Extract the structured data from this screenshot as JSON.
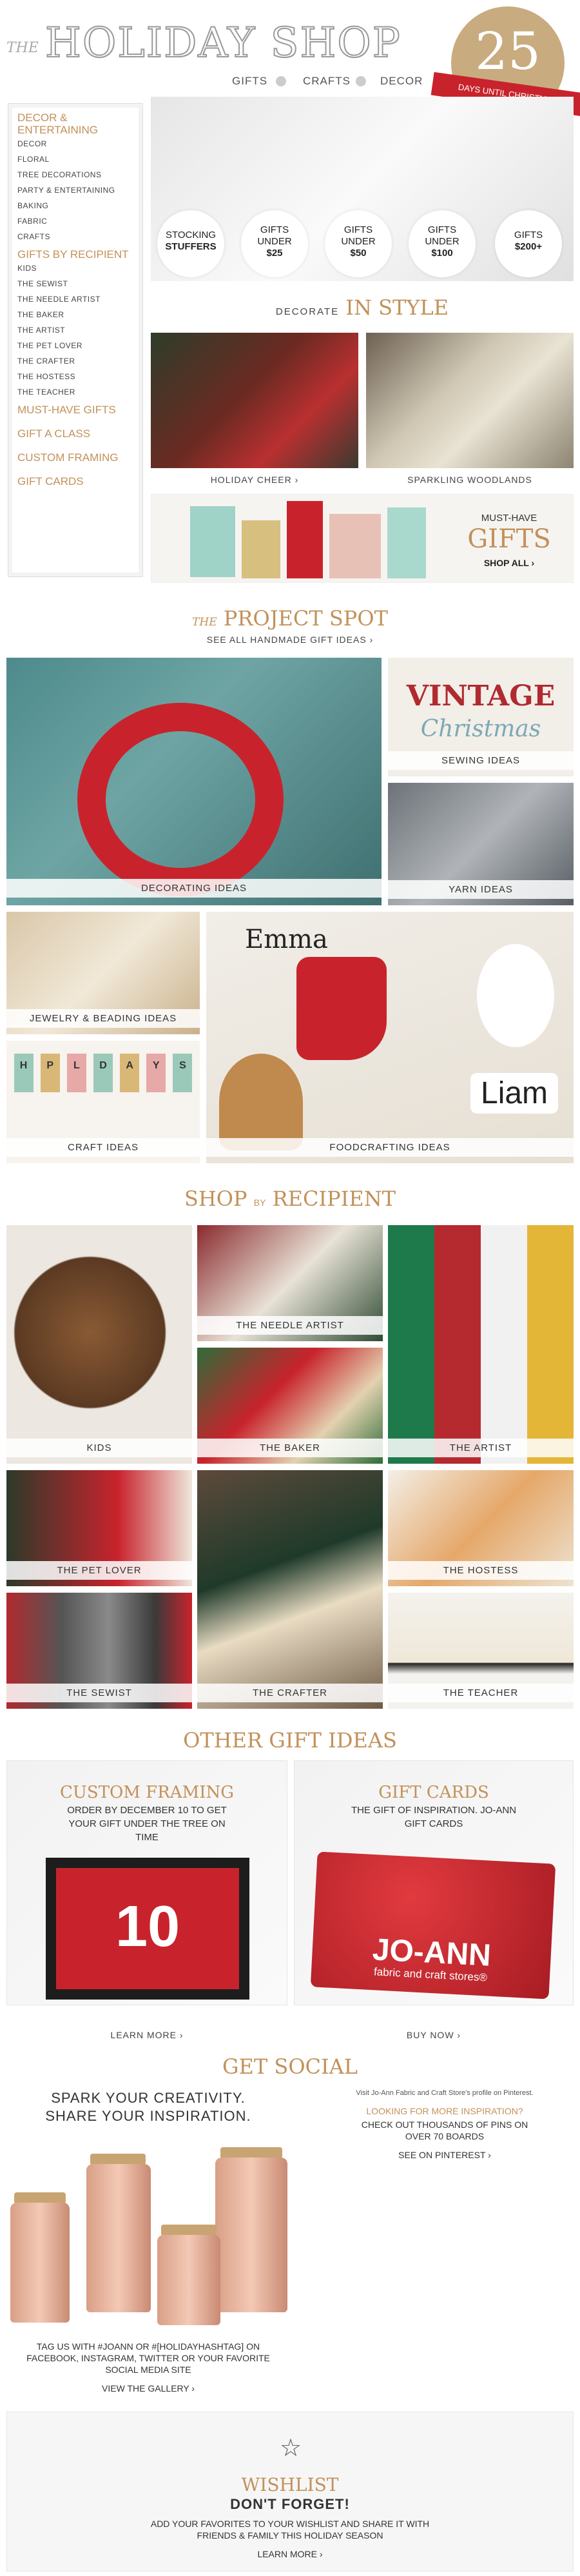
{
  "header": {
    "the": "THE",
    "title": "HOLIDAY SHOP",
    "nav": [
      "GIFTS",
      "CRAFTS",
      "DECOR"
    ],
    "countdown_number": "25",
    "countdown_label": "DAYS UNTIL CHRISTMAS"
  },
  "sidebar": {
    "groups": [
      {
        "title": "DECOR & ENTERTAINING",
        "items": [
          "DECOR",
          "FLORAL",
          "TREE DECORATIONS",
          "PARTY & ENTERTAINING",
          "BAKING",
          "FABRIC",
          "CRAFTS"
        ]
      },
      {
        "title": "GIFTS BY RECIPIENT",
        "items": [
          "KIDS",
          "THE SEWIST",
          "THE NEEDLE ARTIST",
          "THE BAKER",
          "THE ARTIST",
          "THE PET LOVER",
          "THE CRAFTER",
          "THE HOSTESS",
          "THE TEACHER"
        ]
      },
      {
        "title": "MUST-HAVE GIFTS",
        "items": []
      },
      {
        "title": "GIFT A CLASS",
        "items": []
      },
      {
        "title": "CUSTOM FRAMING",
        "items": []
      },
      {
        "title": "GIFT CARDS",
        "items": []
      }
    ]
  },
  "hero": {
    "circles": [
      {
        "line1": "STOCKING",
        "line2": "STUFFERS"
      },
      {
        "line1": "GIFTS",
        "line2": "UNDER",
        "line3": "$25"
      },
      {
        "line1": "GIFTS",
        "line2": "UNDER",
        "line3": "$50"
      },
      {
        "line1": "GIFTS",
        "line2": "UNDER",
        "line3": "$100"
      },
      {
        "line1": "GIFTS",
        "line2": "$200+"
      }
    ]
  },
  "decorate": {
    "prefix": "DECORATE",
    "title": "IN STYLE",
    "items": [
      "HOLIDAY CHEER ›",
      "SPARKLING WOODLANDS"
    ]
  },
  "musthave": {
    "line1": "MUST-HAVE",
    "line2": "GIFTS",
    "cta": "SHOP ALL ›"
  },
  "project": {
    "prefix": "THE",
    "title": "PROJECT SPOT",
    "link": "SEE ALL HANDMADE GIFT IDEAS ›",
    "tiles": [
      "DECORATING IDEAS",
      "SEWING IDEAS",
      "YARN IDEAS",
      "JEWELRY & BEADING IDEAS",
      "CRAFT IDEAS",
      "FOODCRAFTING IDEAS"
    ],
    "vintage": "VINTAGE",
    "christmas": "Christmas",
    "names": [
      "Emma",
      "Liam"
    ],
    "banner_letters": [
      "H",
      "P",
      "L",
      "D",
      "A",
      "Y",
      "S"
    ]
  },
  "recipient": {
    "left": "SHOP",
    "by": "BY",
    "right": "RECIPIENT",
    "tiles": [
      "KIDS",
      "THE NEEDLE ARTIST",
      "THE BAKER",
      "THE ARTIST",
      "THE PET LOVER",
      "THE HOSTESS",
      "THE SEWIST",
      "THE CRAFTER",
      "THE TEACHER"
    ]
  },
  "other": {
    "title": "OTHER GIFT IDEAS",
    "framing": {
      "title": "CUSTOM FRAMING",
      "text": "ORDER BY DECEMBER 10 TO GET YOUR GIFT UNDER THE TREE ON TIME",
      "cta": "LEARN MORE ›",
      "jersey": "10"
    },
    "giftcard": {
      "title": "GIFT CARDS",
      "text": "THE GIFT OF INSPIRATION. JO-ANN GIFT CARDS",
      "cta": "BUY NOW ›",
      "brand": "JO-ANN",
      "tagline": "fabric and craft stores®"
    }
  },
  "social": {
    "title": "GET SOCIAL",
    "headline": "SPARK YOUR CREATIVITY. SHARE YOUR INSPIRATION.",
    "small": "Visit Jo-Ann Fabric and Craft Store's profile on Pinterest.",
    "pin_title": "LOOKING FOR MORE INSPIRATION?",
    "pin_text": "CHECK OUT THOUSANDS OF PINS ON OVER 70 BOARDS",
    "pin_cta": "SEE ON PINTEREST ›",
    "tag_text": "TAG US WITH #JOANN OR #[HOLIDAYHASHTAG] ON FACEBOOK, INSTAGRAM, TWITTER OR YOUR FAVORITE SOCIAL MEDIA SITE",
    "gallery": "VIEW THE GALLERY ›"
  },
  "wishlist": {
    "title": "WISHLIST",
    "headline": "DON'T FORGET!",
    "text": "ADD YOUR FAVORITES TO YOUR WISHLIST AND SHARE IT WITH FRIENDS & FAMILY THIS HOLIDAY SEASON",
    "cta": "LEARN MORE ›"
  },
  "colors": {
    "gold": "#c2915a",
    "red": "#c8232c"
  }
}
